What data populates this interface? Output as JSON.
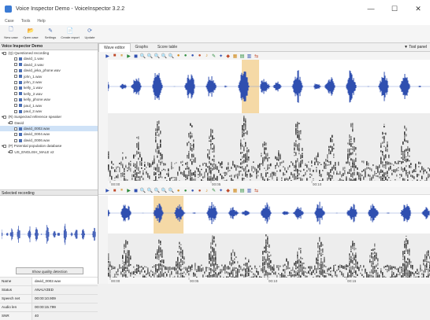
{
  "window": {
    "title": "Voice Inspector Demo - VoiceInspector 3.2.2",
    "controls": [
      "—",
      "☐",
      "✕"
    ]
  },
  "menu": [
    "Case",
    "Tools",
    "Help"
  ],
  "toolbar": [
    {
      "label": "New case",
      "icon": "new-case-icon",
      "glyph": "🗋"
    },
    {
      "label": "Open case",
      "icon": "open-case-icon",
      "glyph": "📂"
    },
    {
      "label": "Settings",
      "icon": "settings-icon",
      "glyph": "✎"
    },
    {
      "label": "Create report",
      "icon": "report-icon",
      "glyph": "📄"
    },
    {
      "label": "Update",
      "icon": "update-icon",
      "glyph": "⟳"
    }
  ],
  "left": {
    "panel_title": "Voice Inspector Demo",
    "tree": [
      {
        "label": "(Q) Questioned recording",
        "level": 0,
        "type": "group"
      },
      {
        "label": "david_1.wav",
        "level": 2,
        "type": "file"
      },
      {
        "label": "david_2.wav",
        "level": 2,
        "type": "file"
      },
      {
        "label": "david_jeka_phone.wav",
        "level": 2,
        "type": "file"
      },
      {
        "label": "john_1.wav",
        "level": 2,
        "type": "file"
      },
      {
        "label": "john_2.wav",
        "level": 2,
        "type": "file"
      },
      {
        "label": "kelly_1.wav",
        "level": 2,
        "type": "file"
      },
      {
        "label": "kelly_2.wav",
        "level": 2,
        "type": "file"
      },
      {
        "label": "kelly_phone.wav",
        "level": 2,
        "type": "file"
      },
      {
        "label": "paul_1.wav",
        "level": 2,
        "type": "file"
      },
      {
        "label": "paul_2.wav",
        "level": 2,
        "type": "file"
      },
      {
        "label": "(R) Suspected reference speaker",
        "level": 0,
        "type": "group"
      },
      {
        "label": "David",
        "level": 1,
        "type": "group"
      },
      {
        "label": "david_0002.wav",
        "level": 2,
        "type": "file",
        "selected": true
      },
      {
        "label": "david_0004.wav",
        "level": 2,
        "type": "file"
      },
      {
        "label": "david_0006.wav",
        "level": 2,
        "type": "file"
      },
      {
        "label": "(P) Potential population database",
        "level": 0,
        "type": "group"
      },
      {
        "label": "US_ENGLISH_MALE v2",
        "level": 1,
        "type": "group"
      }
    ],
    "selected_recording_title": "Selected recording",
    "quality_button": "Show quality detection",
    "properties": [
      {
        "key": "Name",
        "value": "david_0002.wav"
      },
      {
        "key": "Status",
        "value": "ANALYZED"
      },
      {
        "key": "Speech net",
        "value": "00:00:10.909"
      },
      {
        "key": "Audio len",
        "value": "00:00:15.799"
      },
      {
        "key": "SNR",
        "value": "40"
      }
    ]
  },
  "right": {
    "tabs": [
      "Wave editor",
      "Graphs",
      "Score table"
    ],
    "active_tab": 0,
    "tab_right": "▼  Tool panel",
    "toolbar_glyphs": [
      "▶",
      "■",
      "⏸",
      "▶",
      "◼",
      "🔍",
      "🔍",
      "🔍",
      "🔍",
      "🔍",
      "●",
      "●",
      "●",
      "●",
      "♪",
      "✎",
      "✦",
      "◆",
      "▦",
      "▤",
      "▥",
      "⇆"
    ],
    "upper_ticks": [
      "00:00",
      "00:05",
      "00:10"
    ],
    "lower_ticks": [
      "00:00",
      "00:05",
      "00:10",
      "00:15"
    ]
  },
  "colors": {
    "wave": "#2f4fb0",
    "highlight": "#f5d9a6",
    "selected": "#cfe2f7",
    "spectrogram_bg": "#ededed"
  }
}
